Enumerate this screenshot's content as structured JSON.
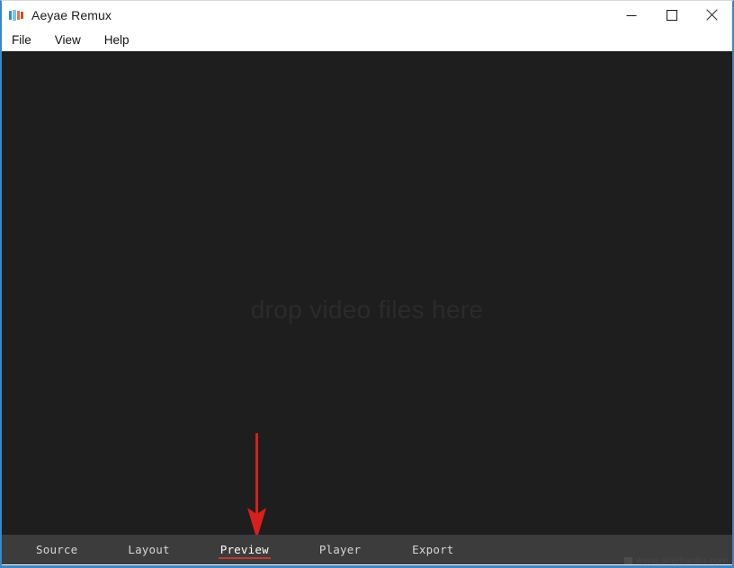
{
  "window": {
    "title": "Aeyae Remux",
    "icon": "app-logo-icon",
    "controls": {
      "minimize": "minimize-icon",
      "maximize": "maximize-icon",
      "close": "close-icon"
    },
    "accent_border_color": "#3a87c8"
  },
  "menu": {
    "items": [
      {
        "label": "File"
      },
      {
        "label": "View"
      },
      {
        "label": "Help"
      }
    ]
  },
  "main": {
    "drop_hint": "drop video files here",
    "background_color": "#1e1e1e",
    "hint_color": "#2b2b2b"
  },
  "annotation": {
    "type": "arrow",
    "direction": "down",
    "color": "#d81f1f",
    "points_at": "Preview"
  },
  "tabs": {
    "active": "Preview",
    "active_underline_color": "#c0392b",
    "items": [
      {
        "label": "Source",
        "active": false
      },
      {
        "label": "Layout",
        "active": false
      },
      {
        "label": "Preview",
        "active": true
      },
      {
        "label": "Player",
        "active": false
      },
      {
        "label": "Export",
        "active": false
      }
    ]
  },
  "watermark": {
    "text": "www.ajiedianjiu.com"
  }
}
